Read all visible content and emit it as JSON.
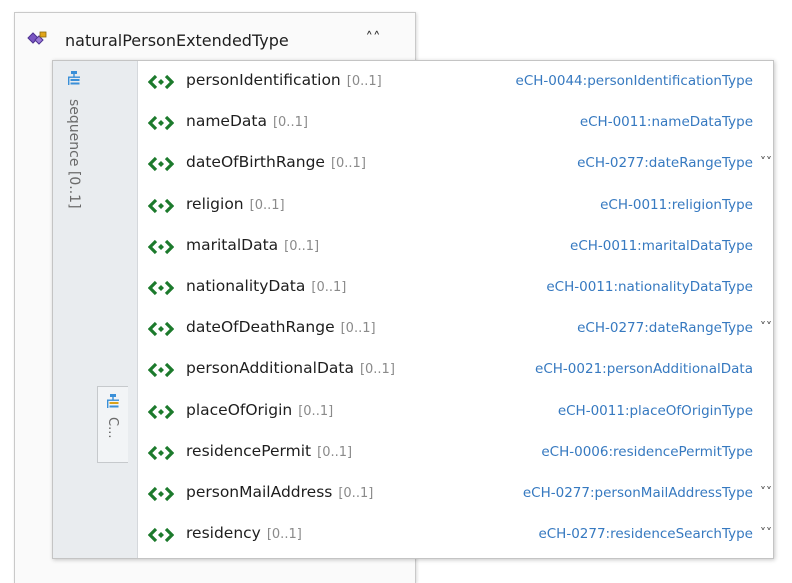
{
  "header": {
    "title": "naturalPersonExtendedType"
  },
  "sequence": {
    "label": "sequence [0..1]"
  },
  "choice": {
    "label": "C..."
  },
  "elements": [
    {
      "name": "personIdentification",
      "cardinality": "[0..1]",
      "type": "eCH-0044:personIdentificationType",
      "expandable": false
    },
    {
      "name": "nameData",
      "cardinality": "[0..1]",
      "type": "eCH-0011:nameDataType",
      "expandable": false
    },
    {
      "name": "dateOfBirthRange",
      "cardinality": "[0..1]",
      "type": "eCH-0277:dateRangeType",
      "expandable": true
    },
    {
      "name": "religion",
      "cardinality": "[0..1]",
      "type": "eCH-0011:religionType",
      "expandable": false
    },
    {
      "name": "maritalData",
      "cardinality": "[0..1]",
      "type": "eCH-0011:maritalDataType",
      "expandable": false
    },
    {
      "name": "nationalityData",
      "cardinality": "[0..1]",
      "type": "eCH-0011:nationalityDataType",
      "expandable": false
    },
    {
      "name": "dateOfDeathRange",
      "cardinality": "[0..1]",
      "type": "eCH-0277:dateRangeType",
      "expandable": true
    },
    {
      "name": "personAdditionalData",
      "cardinality": "[0..1]",
      "type": "eCH-0021:personAdditionalData",
      "expandable": false
    },
    {
      "name": "placeOfOrigin",
      "cardinality": "[0..1]",
      "type": "eCH-0011:placeOfOriginType",
      "expandable": false
    },
    {
      "name": "residencePermit",
      "cardinality": "[0..1]",
      "type": "eCH-0006:residencePermitType",
      "expandable": false
    },
    {
      "name": "personMailAddress",
      "cardinality": "[0..1]",
      "type": "eCH-0277:personMailAddressType",
      "expandable": true
    },
    {
      "name": "residency",
      "cardinality": "[0..1]",
      "type": "eCH-0277:residenceSearchType",
      "expandable": true
    }
  ],
  "icons": {
    "type": "complex-type-icon",
    "collapse": "double-chevron-up-icon",
    "sequence": "sequence-icon",
    "choice": "choice-icon",
    "element": "element-icon",
    "expand": "double-chevron-down-icon"
  },
  "colors": {
    "type_link": "#3679c0",
    "element_icon": "#1c7a2c",
    "sequence_icon": "#3a8fd8"
  }
}
